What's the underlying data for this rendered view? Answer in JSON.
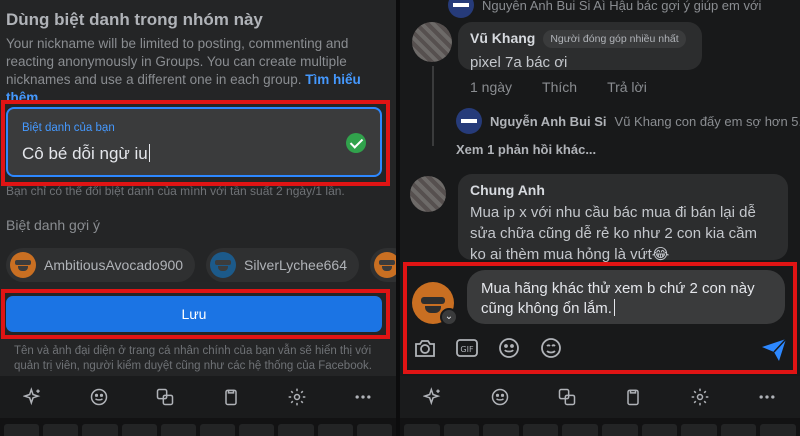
{
  "left": {
    "title": "Dùng biệt danh trong nhóm này",
    "description": "Your nickname will be limited to posting, commenting and reacting anonymously in Groups. You can create multiple nicknames and use a different one in each group.",
    "learn_more": "Tìm hiểu thêm",
    "nickname_label": "Biệt danh của bạn",
    "nickname_value": "Cô bé dỗi ngừ iu",
    "frequency_note": "Bạn chỉ có thể đổi biệt danh của mình với tần suất 2 ngày/1 lần.",
    "suggestions_title": "Biệt danh gợi ý",
    "suggestions": [
      "AmbitiousAvocado900",
      "SilverLychee664"
    ],
    "save_label": "Lưu",
    "privacy_note": "Tên và ảnh đại diện ở trang cá nhân chính của bạn vẫn sẽ hiển thị với quản trị viên, người kiểm duyệt cũng như các hệ thống của Facebook."
  },
  "right": {
    "top_partial_reply": "Nguyễn Anh Bui Si  Aì Hậu bác gợi ý giúp em với",
    "comment1": {
      "author": "Vũ Khang",
      "badge": "Người đóng góp nhiều nhất",
      "text": "pixel 7a bác ơi",
      "time": "1 ngày",
      "like": "Thích",
      "reply": "Trả lời"
    },
    "reply1": {
      "author": "Nguyễn Anh Bui Si",
      "text": "Vũ Khang con đấy em sợ hơn 5..."
    },
    "more_replies": "Xem 1 phản hồi khác...",
    "comment2": {
      "author": "Chung Anh",
      "text": "Mua ip x với nhu cầu bác mua đi bán lại dễ sửa chữa cũng dễ rẻ ko như 2 con kia cầm ko ai thèm mua hỏng là vứt😂"
    },
    "composer_text": "Mua hãng khác thử xem b chứ 2 con này cũng không ổn lắm."
  },
  "icons": {
    "toolbar": [
      "sparkle-icon",
      "emoji-icon",
      "translate-icon",
      "clipboard-icon",
      "settings-icon",
      "more-icon"
    ],
    "composer_tools": [
      "camera-icon",
      "gif-icon",
      "emoji-icon",
      "sticker-icon",
      "send-icon"
    ]
  },
  "colors": {
    "accent": "#1b74e4",
    "highlight": "#e01414",
    "success": "#31a24c"
  }
}
